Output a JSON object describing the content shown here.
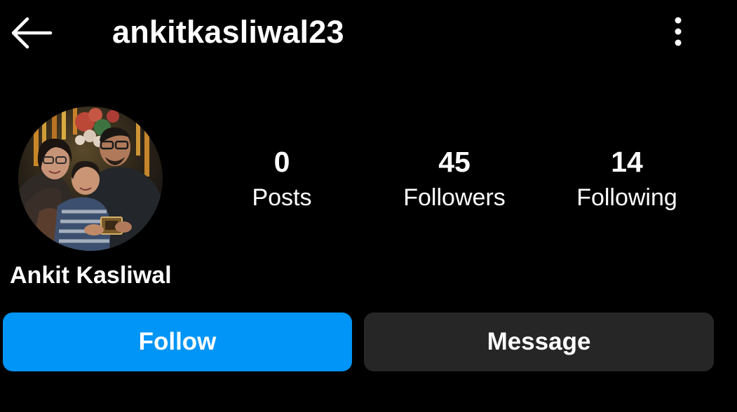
{
  "header": {
    "username": "ankitkasliwal23",
    "back_icon": "arrow-left-icon",
    "more_icon": "more-vertical-icon"
  },
  "profile": {
    "display_name": "Ankit Kasliwal",
    "avatar": "profile-photo"
  },
  "stats": [
    {
      "value": "0",
      "label": "Posts"
    },
    {
      "value": "45",
      "label": "Followers"
    },
    {
      "value": "14",
      "label": "Following"
    }
  ],
  "actions": {
    "follow_label": "Follow",
    "message_label": "Message"
  },
  "colors": {
    "background": "#000000",
    "text": "#ffffff",
    "follow_button": "#0095f6",
    "message_button": "#262626"
  }
}
